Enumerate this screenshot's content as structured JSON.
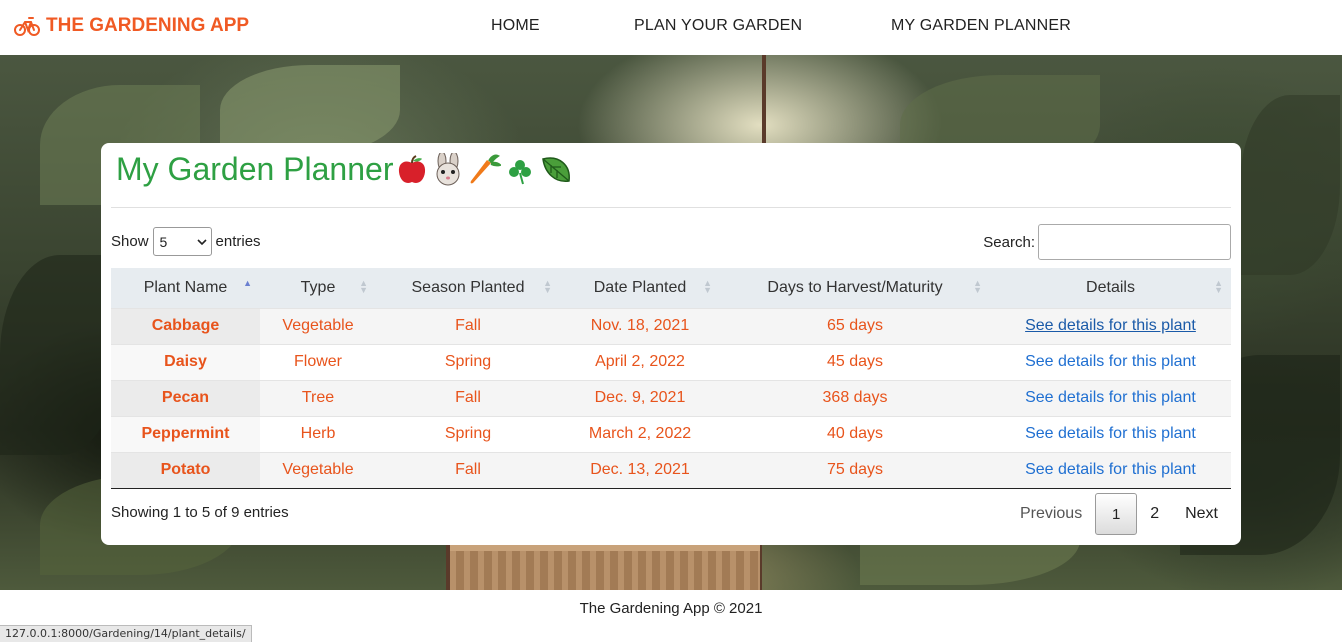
{
  "navbar": {
    "brand": "THE GARDENING APP",
    "brand_icon": "bicycle-icon",
    "links": [
      "HOME",
      "PLAN YOUR GARDEN",
      "MY GARDEN PLANNER"
    ]
  },
  "colors": {
    "brand": "#f05a24",
    "title": "#2ea043",
    "cell_text": "#e8541c",
    "link": "#1f6fd1"
  },
  "card": {
    "title": "My Garden Planner",
    "emojis": [
      "apple-icon",
      "rabbit-icon",
      "carrot-icon",
      "shamrock-icon",
      "leaf-icon"
    ]
  },
  "length": {
    "show": "Show",
    "value": "5",
    "entries": "entries"
  },
  "search": {
    "label": "Search:",
    "value": ""
  },
  "table": {
    "columns": [
      "Plant Name",
      "Type",
      "Season Planted",
      "Date Planted",
      "Days to Harvest/Maturity",
      "Details"
    ],
    "sorted_column": "Plant Name",
    "rows": [
      {
        "name": "Cabbage",
        "type": "Vegetable",
        "season": "Fall",
        "date": "Nov. 18, 2021",
        "days": "65 days",
        "details": "See details for this plant"
      },
      {
        "name": "Daisy",
        "type": "Flower",
        "season": "Spring",
        "date": "April 2, 2022",
        "days": "45 days",
        "details": "See details for this plant"
      },
      {
        "name": "Pecan",
        "type": "Tree",
        "season": "Fall",
        "date": "Dec. 9, 2021",
        "days": "368 days",
        "details": "See details for this plant"
      },
      {
        "name": "Peppermint",
        "type": "Herb",
        "season": "Spring",
        "date": "March 2, 2022",
        "days": "40 days",
        "details": "See details for this plant"
      },
      {
        "name": "Potato",
        "type": "Vegetable",
        "season": "Fall",
        "date": "Dec. 13, 2021",
        "days": "75 days",
        "details": "See details for this plant"
      }
    ]
  },
  "info": "Showing 1 to 5 of 9 entries",
  "pager": {
    "previous": "Previous",
    "pages": [
      "1",
      "2"
    ],
    "current": "1",
    "next": "Next"
  },
  "footer": "The Gardening App © 2021",
  "status_url": "127.0.0.1:8000/Gardening/14/plant_details/"
}
